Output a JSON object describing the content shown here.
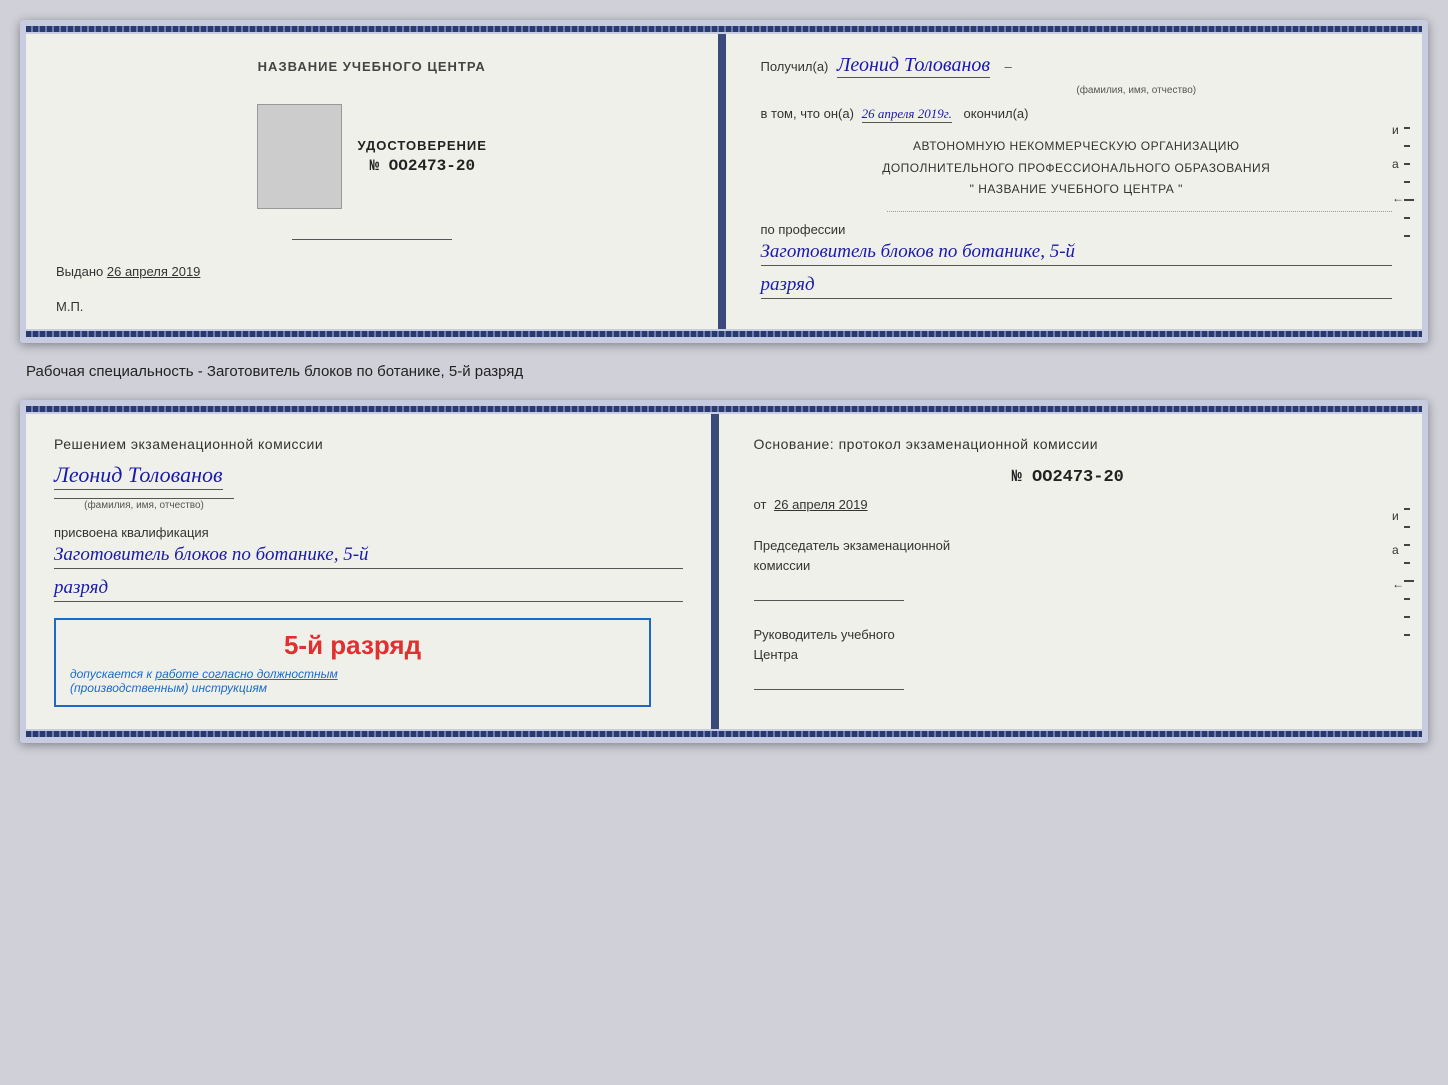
{
  "topDoc": {
    "left": {
      "centerTitle": "НАЗВАНИЕ УЧЕБНОГО ЦЕНТРА",
      "certLabel": "УДОСТОВЕРЕНИЕ",
      "certNumber": "№ OO2473-20",
      "issuedLabel": "Выдано",
      "issuedDate": "26 апреля 2019",
      "mpLabel": "М.П."
    },
    "right": {
      "recipientPrefix": "Получил(а)",
      "recipientName": "Леонид Толованов",
      "fioLabel": "(фамилия, имя, отчество)",
      "completedPrefix": "в том, что он(а)",
      "completedDate": "26 апреля 2019г.",
      "completedSuffix": "окончил(а)",
      "orgLine1": "АВТОНОМНУЮ НЕКОММЕРЧЕСКУЮ ОРГАНИЗАЦИЮ",
      "orgLine2": "ДОПОЛНИТЕЛЬНОГО ПРОФЕССИОНАЛЬНОГО ОБРАЗОВАНИЯ",
      "orgLine3": "\"  НАЗВАНИЕ УЧЕБНОГО ЦЕНТРА  \"",
      "professionLabel": "по профессии",
      "professionValue": "Заготовитель блоков по ботанике, 5-й",
      "razryadValue": "разряд"
    }
  },
  "descriptionLine": "Рабочая специальность - Заготовитель блоков по ботанике, 5-й разряд",
  "bottomDoc": {
    "left": {
      "decisionTitle": "Решением экзаменационной комиссии",
      "personName": "Леонид Толованов",
      "fioLabel": "(фамилия, имя, отчество)",
      "qualificationLabel": "присвоена квалификация",
      "qualificationValue": "Заготовитель блоков по ботанике, 5-й",
      "razryadValue": "разряд",
      "stampGrade": "5-й разряд",
      "stampAllowedText": "допускается к",
      "stampWorkText": "работе согласно должностным",
      "stampInstructionsText": "(производственным) инструкциям"
    },
    "right": {
      "basisTitle": "Основание: протокол экзаменационной комиссии",
      "protocolNumber": "№  OO2473-20",
      "fromLabel": "от",
      "fromDate": "26 апреля 2019",
      "chairmanLabel": "Председатель экзаменационной",
      "chairmanLabel2": "комиссии",
      "headLabel": "Руководитель учебного",
      "headLabel2": "Центра"
    }
  }
}
